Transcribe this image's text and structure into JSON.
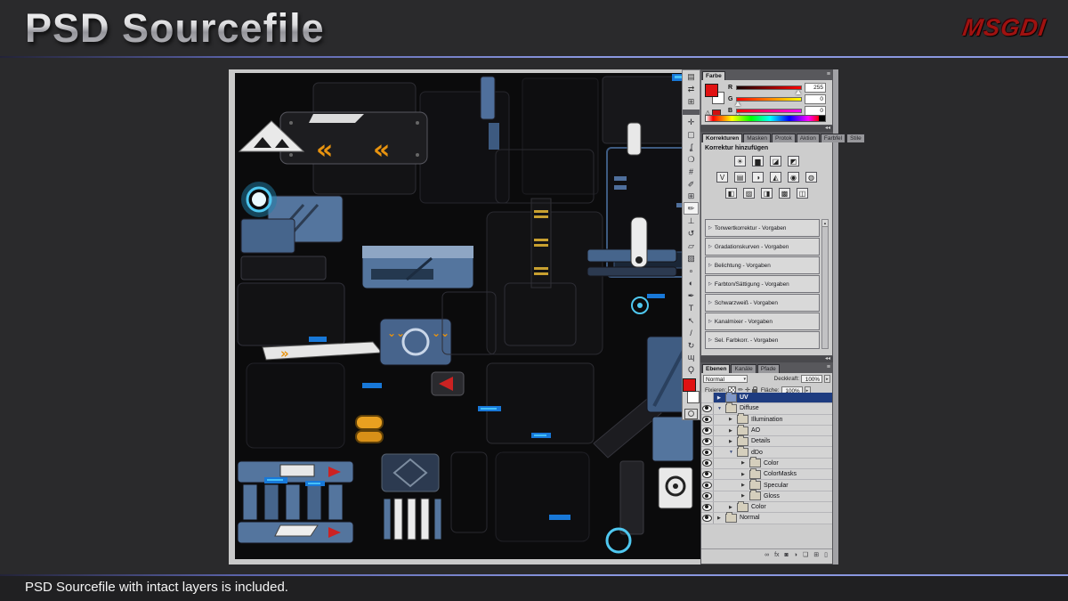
{
  "slide": {
    "title": "PSD Sourcefile",
    "logo": "MSGDI",
    "footer": "PSD Sourcefile with intact layers is included."
  },
  "colors": {
    "slide_background": "#2a2a2c",
    "accent_blue_line": "#8a97e0",
    "logo_red": "#9e1210",
    "layer_selection_navy": "#1e3c80",
    "texture_blue": "#54759e",
    "texture_orange": "#e8930f",
    "glow_cyan": "#4fc8f0",
    "foreground_swatch": "#e01212",
    "background_swatch": "#ffffff"
  },
  "glyphs": {
    "menu": "≡",
    "collapse": "◂◂",
    "dropdown": "▾",
    "spinner": "▸",
    "warning": "⚠",
    "scroll_up": "▲",
    "preset_arrow": "▷",
    "tri_closed": "▶",
    "tri_open": "▼"
  },
  "toolbar": {
    "dock_icons": [
      {
        "name": "panel-dock-icon-1",
        "glyph": "▤"
      },
      {
        "name": "panel-dock-icon-2",
        "glyph": "⇄"
      },
      {
        "name": "panel-dock-icon-3",
        "glyph": "⊞"
      }
    ],
    "tools": [
      {
        "name": "move-tool",
        "glyph": "✛"
      },
      {
        "name": "marquee-tool",
        "glyph": "▢"
      },
      {
        "name": "lasso-tool",
        "glyph": "ʆ"
      },
      {
        "name": "quick-selection-tool",
        "glyph": "❍"
      },
      {
        "name": "crop-tool",
        "glyph": "#"
      },
      {
        "name": "eyedropper-tool",
        "glyph": "✐"
      },
      {
        "name": "healing-brush-tool",
        "glyph": "⊞"
      },
      {
        "name": "brush-tool",
        "glyph": "✏",
        "selected": true
      },
      {
        "name": "clone-stamp-tool",
        "glyph": "⊥"
      },
      {
        "name": "history-brush-tool",
        "glyph": "↺"
      },
      {
        "name": "eraser-tool",
        "glyph": "▱"
      },
      {
        "name": "gradient-tool",
        "glyph": "▧"
      },
      {
        "name": "blur-tool",
        "glyph": "∘"
      },
      {
        "name": "dodge-tool",
        "glyph": "◐"
      },
      {
        "name": "pen-tool",
        "glyph": "✒"
      },
      {
        "name": "type-tool",
        "glyph": "T"
      },
      {
        "name": "path-selection-tool",
        "glyph": "↖"
      },
      {
        "name": "line-tool",
        "glyph": "/"
      },
      {
        "name": "rotate-view-tool",
        "glyph": "↻"
      },
      {
        "name": "hand-tool",
        "glyph": "ɰ"
      },
      {
        "name": "zoom-tool",
        "glyph": "Ϙ"
      }
    ]
  },
  "color_panel": {
    "tab": "Farbe",
    "channels": [
      {
        "label": "R",
        "value": "255"
      },
      {
        "label": "G",
        "value": "0"
      },
      {
        "label": "B",
        "value": "0"
      }
    ]
  },
  "adjustments_panel": {
    "tabs": [
      "Korrekturen",
      "Masken",
      "Protok",
      "Aktion",
      "Farbfel",
      "Stile"
    ],
    "header": "Korrektur hinzufügen",
    "icons": [
      {
        "name": "brightness-contrast",
        "glyph": "☀"
      },
      {
        "name": "levels",
        "glyph": "▆"
      },
      {
        "name": "curves",
        "glyph": "◪"
      },
      {
        "name": "exposure",
        "glyph": "◩"
      },
      {
        "name": "vibrance",
        "glyph": "V"
      },
      {
        "name": "hue-saturation",
        "glyph": "▤"
      },
      {
        "name": "color-balance",
        "glyph": "◑"
      },
      {
        "name": "black-white",
        "glyph": "◭"
      },
      {
        "name": "photo-filter",
        "glyph": "◉"
      },
      {
        "name": "channel-mixer",
        "glyph": "◍"
      },
      {
        "name": "invert",
        "glyph": "◧"
      },
      {
        "name": "posterize",
        "glyph": "▨"
      },
      {
        "name": "threshold",
        "glyph": "◨"
      },
      {
        "name": "gradient-map",
        "glyph": "▩"
      },
      {
        "name": "selective-color",
        "glyph": "◫"
      }
    ],
    "presets": [
      "Tonwertkorrektur - Vorgaben",
      "Gradationskurven - Vorgaben",
      "Belichtung - Vorgaben",
      "Farbton/Sättigung - Vorgaben",
      "Schwarzweiß - Vorgaben",
      "Kanalmixer - Vorgaben",
      "Sel. Farbkorr. - Vorgaben"
    ]
  },
  "layers_panel": {
    "tabs": [
      "Ebenen",
      "Kanäle",
      "Pfade"
    ],
    "blend_mode": "Normal",
    "opacity_label": "Deckkraft:",
    "opacity_value": "100%",
    "lock_label": "Fixieren:",
    "fill_label": "Fläche:",
    "fill_value": "100%",
    "layers": [
      {
        "name": "UV",
        "indent": 0,
        "selected": true,
        "visible": false,
        "expanded": false
      },
      {
        "name": "Diffuse",
        "indent": 0,
        "visible": true,
        "expanded": true
      },
      {
        "name": "Illumination",
        "indent": 1,
        "visible": true,
        "expanded": false
      },
      {
        "name": "AO",
        "indent": 1,
        "visible": true,
        "expanded": false
      },
      {
        "name": "Details",
        "indent": 1,
        "visible": true,
        "expanded": false
      },
      {
        "name": "dDo",
        "indent": 1,
        "visible": true,
        "expanded": true
      },
      {
        "name": "Color",
        "indent": 2,
        "visible": true,
        "expanded": false
      },
      {
        "name": "ColorMasks",
        "indent": 2,
        "visible": true,
        "expanded": false
      },
      {
        "name": "Specular",
        "indent": 2,
        "visible": true,
        "expanded": false
      },
      {
        "name": "Gloss",
        "indent": 2,
        "visible": true,
        "expanded": false
      },
      {
        "name": "Color",
        "indent": 1,
        "visible": true,
        "expanded": false
      },
      {
        "name": "Normal",
        "indent": 0,
        "visible": true,
        "expanded": false
      }
    ],
    "bottom_icons": [
      {
        "name": "link-layers",
        "glyph": "∞"
      },
      {
        "name": "layer-style",
        "glyph": "fx"
      },
      {
        "name": "layer-mask",
        "glyph": "◙"
      },
      {
        "name": "adjustment-layer",
        "glyph": "◑"
      },
      {
        "name": "layer-group",
        "glyph": "❏"
      },
      {
        "name": "new-layer",
        "glyph": "⊞"
      },
      {
        "name": "delete-layer",
        "glyph": "▯"
      }
    ]
  }
}
